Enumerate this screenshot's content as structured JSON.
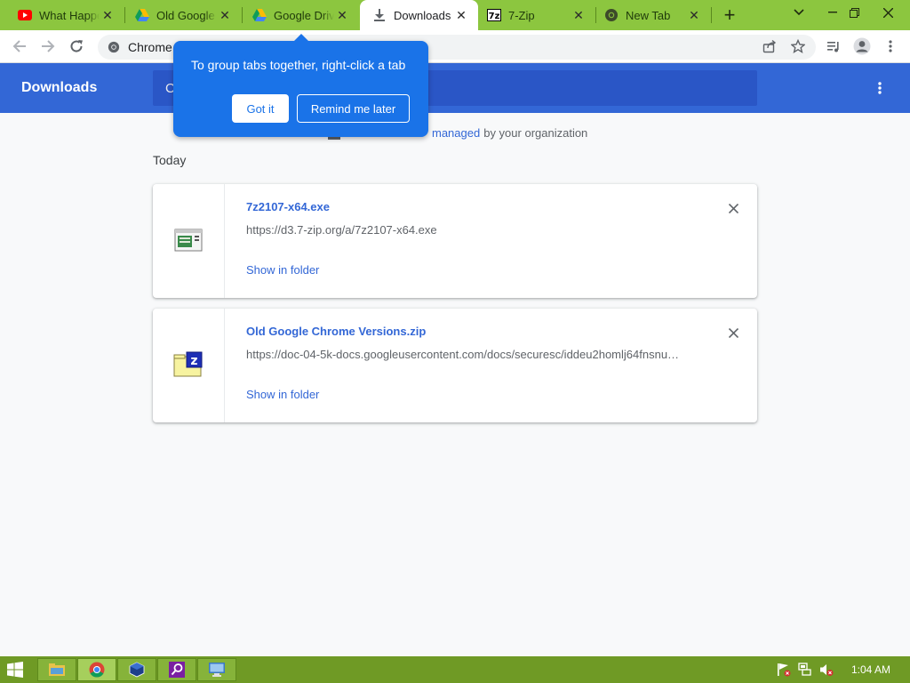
{
  "tabs": [
    {
      "title": "What Happens",
      "icon": "youtube-icon"
    },
    {
      "title": "Old Google Chrome",
      "icon": "google-drive-icon"
    },
    {
      "title": "Google Drive",
      "icon": "google-drive-icon"
    },
    {
      "title": "Downloads",
      "icon": "download-icon"
    },
    {
      "title": "7-Zip",
      "icon": "7zip-icon"
    },
    {
      "title": "New Tab",
      "icon": "chrome-icon"
    }
  ],
  "toolbar": {
    "omnibox_text": "Chrome"
  },
  "downloads": {
    "title": "Downloads",
    "search_placeholder": "C",
    "managed_link": "managed",
    "managed_text": "by your organization",
    "section_today": "Today",
    "items": [
      {
        "file_name": "7z2107-x64.exe",
        "url": "https://d3.7-zip.org/a/7z2107-x64.exe",
        "show_in_folder": "Show in folder"
      },
      {
        "file_name": "Old Google Chrome Versions.zip",
        "url": "https://doc-04-5k-docs.googleusercontent.com/docs/securesc/iddeu2homlj64fnsnu…",
        "show_in_folder": "Show in folder"
      }
    ]
  },
  "bubble": {
    "text": "To group tabs together, right-click a tab",
    "got_it": "Got it",
    "remind_later": "Remind me later"
  },
  "taskbar": {
    "clock": "1:04 AM"
  },
  "colors": {
    "accent": "#3367d6",
    "bubble": "#1a73e8",
    "frame": "#8cc63f",
    "taskbar": "#6f9a25"
  }
}
